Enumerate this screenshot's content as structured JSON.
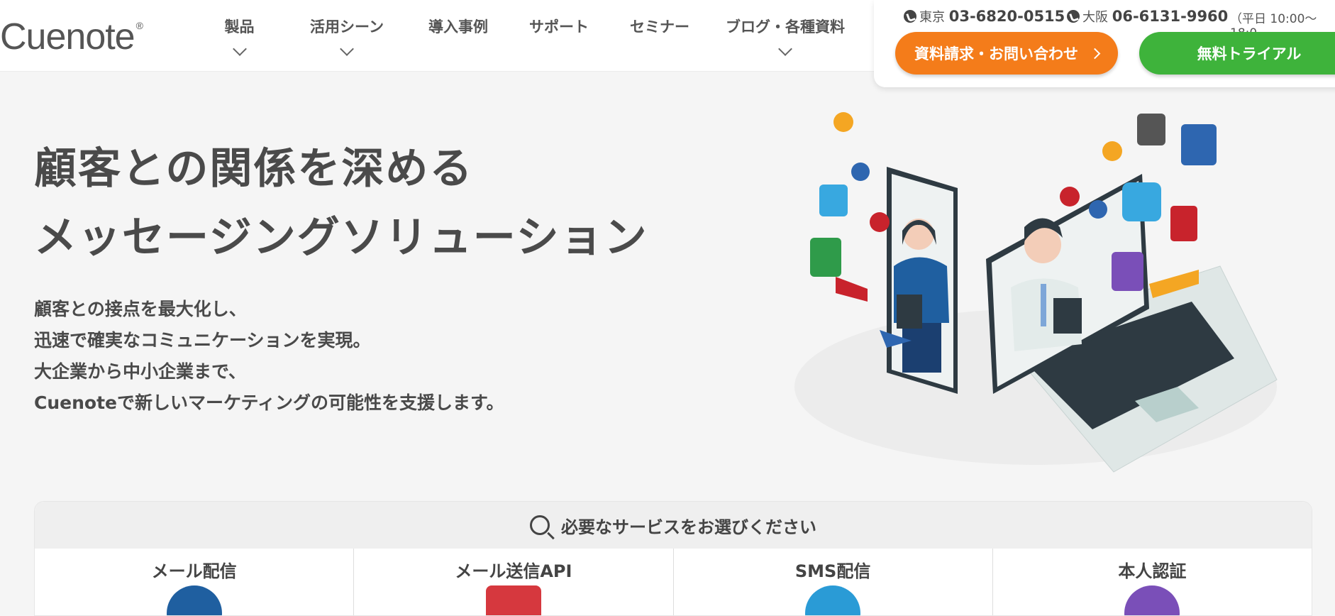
{
  "header": {
    "logo": "Cuenote",
    "logo_mark": "®",
    "nav": [
      {
        "label": "製品",
        "has_dropdown": true
      },
      {
        "label": "活用シーン",
        "has_dropdown": true
      },
      {
        "label": "導入事例",
        "has_dropdown": false
      },
      {
        "label": "サポート",
        "has_dropdown": false
      },
      {
        "label": "セミナー",
        "has_dropdown": false
      },
      {
        "label": "ブログ・各種資料",
        "has_dropdown": true
      }
    ],
    "contact": {
      "tokyo_label": "東京",
      "tokyo_number": "03-6820-0515",
      "osaka_label": "大阪",
      "osaka_number": "06-6131-9960",
      "hours": "（平日 10:00〜18:0"
    },
    "cta_inquiry": "資料請求・お問い合わせ",
    "cta_trial": "無料トライアル"
  },
  "hero": {
    "title_line1": "顧客との関係を深める",
    "title_line2": "メッセージングソリューション",
    "sub_line1": "顧客との接点を最大化し、",
    "sub_line2": "迅速で確実なコミュニケーションを実現。",
    "sub_line3": "大企業から中小企業まで、",
    "sub_line4": "Cuenoteで新しいマーケティングの可能性を支援します。"
  },
  "services": {
    "heading": "必要なサービスをお選びください",
    "items": [
      {
        "label": "メール配信",
        "icon": "mail-delivery-icon",
        "color": "#1f5fa0"
      },
      {
        "label": "メール送信API",
        "icon": "mail-api-icon",
        "color": "#d6383e"
      },
      {
        "label": "SMS配信",
        "icon": "sms-icon",
        "color": "#2a9bd6"
      },
      {
        "label": "本人認証",
        "icon": "authentication-icon",
        "color": "#7a4fb8"
      }
    ]
  },
  "colors": {
    "orange": "#f47c1a",
    "green": "#3eb33b",
    "text": "#4a4a4a"
  }
}
